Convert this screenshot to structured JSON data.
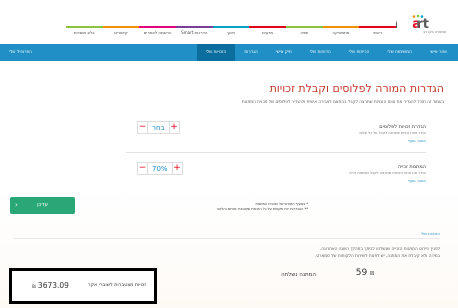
{
  "brand": {
    "logo_text": "smart",
    "logo_sub": "סמארט בקו רב"
  },
  "top_nav": [
    "ראשי",
    "מתמטיקה",
    "שפה",
    "מדעים",
    "חינוך",
    "הדרכות Smart",
    "הרשמה לאתרים",
    "קישורים",
    "בלוג מוסדות"
  ],
  "tabs": [
    "אזור אישי",
    "המשימות שלי",
    "הכיתות שלי",
    "הדוחות שלי",
    "תיק אישי",
    "הגדרות",
    "הזכויות שלי",
    "הפרופיל שלי"
  ],
  "active_tab": "הזכויות שלי",
  "page": {
    "title": "הגדרות המורה לפלוסים וקבלת זכויות",
    "subtitle": "בעמוד זה תוכל להגדיר את טווח הזכויות שתרצה לקבל בהתאם לצבירה אישית ולהגדיר לפלוסים של תכנית המתנות"
  },
  "setting_rights": {
    "label": "הגדרת זכויות לפלוסים",
    "desc": "הגדר טווח זכויות שתרצה לקבל על כל פלוס",
    "link": "הסבר נוסף",
    "value": "בחר",
    "minus": "−",
    "plus": "+"
  },
  "setting_gift": {
    "label": "המתנות זכייה",
    "desc": "הגדר את אחוז הזכויות שתרצה לקבל כמתנות זכייה",
    "link": "הסבר נוסף",
    "value": "70%",
    "minus": "−",
    "plus": "+"
  },
  "update_button": {
    "label": "עדכן",
    "chevron": "‹"
  },
  "notes": [
    "* בסעיף הקודם של תוכנית המתנות",
    "** ההגדרות יהיו תקפות על כל הזכויות שיצטברו מהיום והלאה"
  ],
  "history_link": "הזכויות שלי",
  "info_lines": [
    "לפניך פירוט המתנות הזכייה שנשלחו לביתך במהלך השנה האחרונה.",
    "במידה ולא קיבלת את המתנה, יש לפנות לשירות הלקוחות של סמארט."
  ],
  "gift_sent": {
    "label": "המתנה נשלחה",
    "value": "59",
    "currency": "₪"
  },
  "accumulated": {
    "label": "זכויות מצטברות לשוברי אקר",
    "value": "3673.09",
    "currency": "₪"
  },
  "colors": {
    "accent_blue": "#1f8fc6",
    "title_red": "#c0392b",
    "button_green": "#2aa776",
    "stepper_red": "#e2001a"
  }
}
